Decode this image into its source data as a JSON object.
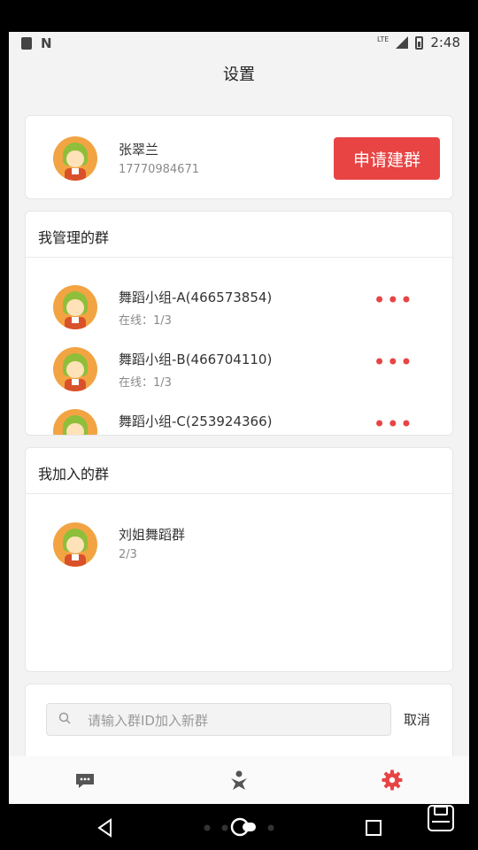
{
  "status_bar": {
    "time": "2:48",
    "network": "LTE"
  },
  "header": {
    "title": "设置"
  },
  "profile": {
    "name": "张翠兰",
    "phone": "17770984671",
    "create_button": "申请建群"
  },
  "managed_groups": {
    "title": "我管理的群",
    "items": [
      {
        "name": "舞蹈小组-A(466573854)",
        "status": "在线：1/3"
      },
      {
        "name": "舞蹈小组-B(466704110)",
        "status": "在线：1/3"
      },
      {
        "name": "舞蹈小组-C(253924366)",
        "status": ""
      }
    ]
  },
  "joined_groups": {
    "title": "我加入的群",
    "items": [
      {
        "name": "刘姐舞蹈群",
        "status": "2/3"
      }
    ]
  },
  "search": {
    "placeholder": "请输入群ID加入新群",
    "value": "",
    "cancel_label": "取消"
  },
  "tabs": [
    {
      "icon": "chat-icon",
      "active": false
    },
    {
      "icon": "person-icon",
      "active": false
    },
    {
      "icon": "gear-icon",
      "active": true
    }
  ],
  "colors": {
    "accent": "#e84444",
    "avatar_bg": "#f2a443",
    "inactive_icon": "#555555"
  }
}
